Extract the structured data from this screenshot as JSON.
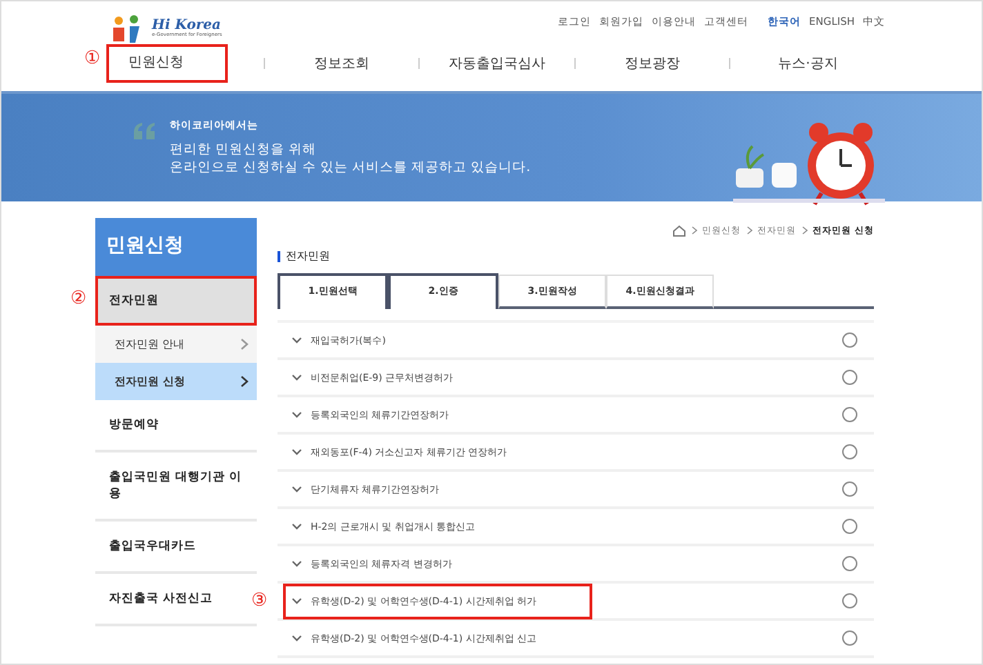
{
  "header": {
    "logo_text": "Hi Korea",
    "logo_tagline": "e-Government for Foreigners",
    "utility_links": [
      "로그인",
      "회원가입",
      "이용안내",
      "고객센터"
    ],
    "languages": [
      {
        "label": "한국어",
        "selected": true
      },
      {
        "label": "ENGLISH",
        "selected": false
      },
      {
        "label": "中文",
        "selected": false
      }
    ],
    "nav": [
      {
        "label": "민원신청",
        "marker": "①"
      },
      {
        "label": "정보조회"
      },
      {
        "label": "자동출입국심사"
      },
      {
        "label": "정보광장"
      },
      {
        "label": "뉴스·공지"
      }
    ]
  },
  "banner": {
    "kicker": "하이코리아에서는",
    "lines": [
      "편리한 민원신청을 위해",
      "온라인으로 신청하실 수 있는 서비스를 제공하고 있습니다."
    ]
  },
  "sidebar": {
    "title": "민원신청",
    "items": [
      {
        "label": "전자민원",
        "selected": true,
        "marker": "②",
        "children": [
          {
            "label": "전자민원 안내",
            "selected": false
          },
          {
            "label": "전자민원 신청",
            "selected": true
          }
        ]
      },
      {
        "label": "방문예약",
        "selected": false
      },
      {
        "label": "출입국민원 대행기관 이용",
        "selected": false
      },
      {
        "label": "출입국우대카드",
        "selected": false
      },
      {
        "label": "자진출국 사전신고",
        "selected": false
      }
    ]
  },
  "breadcrumb": [
    "민원신청",
    "전자민원",
    "전자민원 신청"
  ],
  "section_title": "전자민원",
  "steps": [
    {
      "label": "1.민원선택",
      "active": true
    },
    {
      "label": "2.인증",
      "active": true
    },
    {
      "label": "3.민원작성",
      "active": false
    },
    {
      "label": "4.민원신청결과",
      "active": false
    }
  ],
  "services": [
    {
      "label": "재입국허가(복수)",
      "selected": false
    },
    {
      "label": "비전문취업(E-9) 근무처변경허가",
      "selected": false
    },
    {
      "label": "등록외국인의 체류기간연장허가",
      "selected": false
    },
    {
      "label": "재외동포(F-4) 거소신고자 체류기간 연장허가",
      "selected": false
    },
    {
      "label": "단기체류자 체류기간연장허가",
      "selected": false
    },
    {
      "label": "H-2의 근로개시 및 취업개시 통합신고",
      "selected": false
    },
    {
      "label": "등록외국인의 체류자격 변경허가",
      "selected": false
    },
    {
      "label": "유학생(D-2) 및 어학연수생(D-4-1) 시간제취업 허가",
      "selected": false,
      "marker": "③"
    },
    {
      "label": "유학생(D-2) 및 어학연수생(D-4-1) 시간제취업 신고",
      "selected": false
    }
  ]
}
